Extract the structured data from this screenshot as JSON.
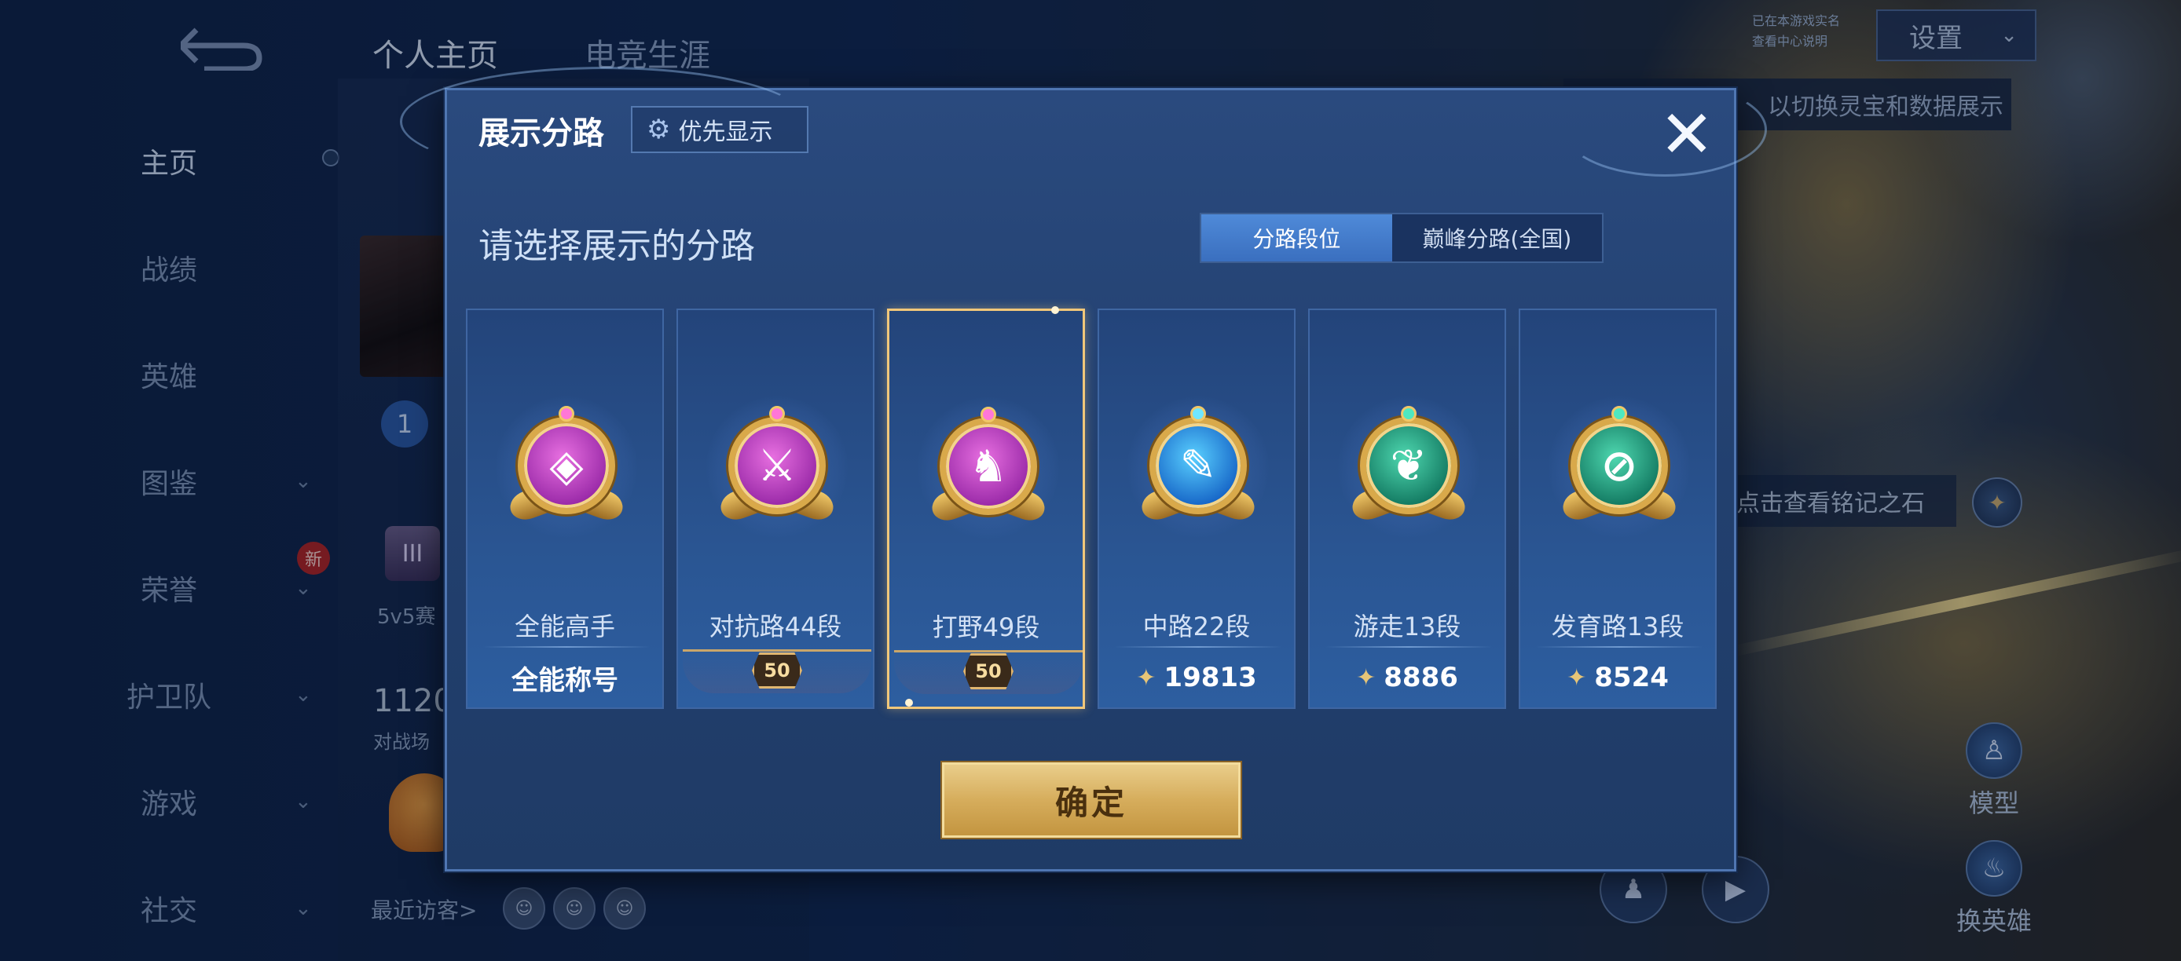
{
  "nav": {
    "items": [
      {
        "label": "主页",
        "active": true
      },
      {
        "label": "战绩"
      },
      {
        "label": "英雄"
      },
      {
        "label": "图鉴"
      },
      {
        "label": "荣誉"
      },
      {
        "label": "护卫队"
      },
      {
        "label": "游戏"
      },
      {
        "label": "社交"
      }
    ],
    "new_badge": "新"
  },
  "tabs": [
    "个人主页",
    "电竞生涯"
  ],
  "profile": {
    "stat_big": "1120",
    "stat_small": "对战场",
    "mode_tag": "5v5赛",
    "trophy_glyph": "III",
    "bolt_glyph": "1",
    "recent_visitors_label": "最近访客>"
  },
  "right": {
    "settings_label": "设置",
    "realname_line1": "已在本游戏实名",
    "realname_line2": "查看中心说明",
    "hint_text": "以切换灵宝和数据展示",
    "mingji_text": "点击查看铭记之石",
    "model_label": "模型",
    "change_hero_label": "换英雄"
  },
  "dialog": {
    "title": "展示分路",
    "priority_label": "优先显示",
    "subtitle": "请选择展示的分路",
    "toggle": {
      "left": "分路段位",
      "right": "巅峰分路(全国)"
    },
    "confirm_label": "确定",
    "cards": [
      {
        "name": "全能高手",
        "value": "全能称号",
        "kind": "title",
        "color": "purple",
        "glyph": "◈"
      },
      {
        "name": "对抗路44段",
        "value": "50",
        "kind": "star",
        "color": "purple",
        "glyph": "⚔"
      },
      {
        "name": "打野49段",
        "value": "50",
        "kind": "star",
        "color": "purple",
        "glyph": "♞",
        "selected": true
      },
      {
        "name": "中路22段",
        "value": "19813",
        "kind": "score",
        "color": "blue",
        "glyph": "✎"
      },
      {
        "name": "游走13段",
        "value": "8886",
        "kind": "score",
        "color": "green",
        "glyph": "❦"
      },
      {
        "name": "发育路13段",
        "value": "8524",
        "kind": "score",
        "color": "green",
        "glyph": "⊘"
      }
    ]
  },
  "colors": {
    "accent_gold": "#f1c77a",
    "toggle_on": "#4f8ad8",
    "dialog_bg": "#22406f"
  }
}
